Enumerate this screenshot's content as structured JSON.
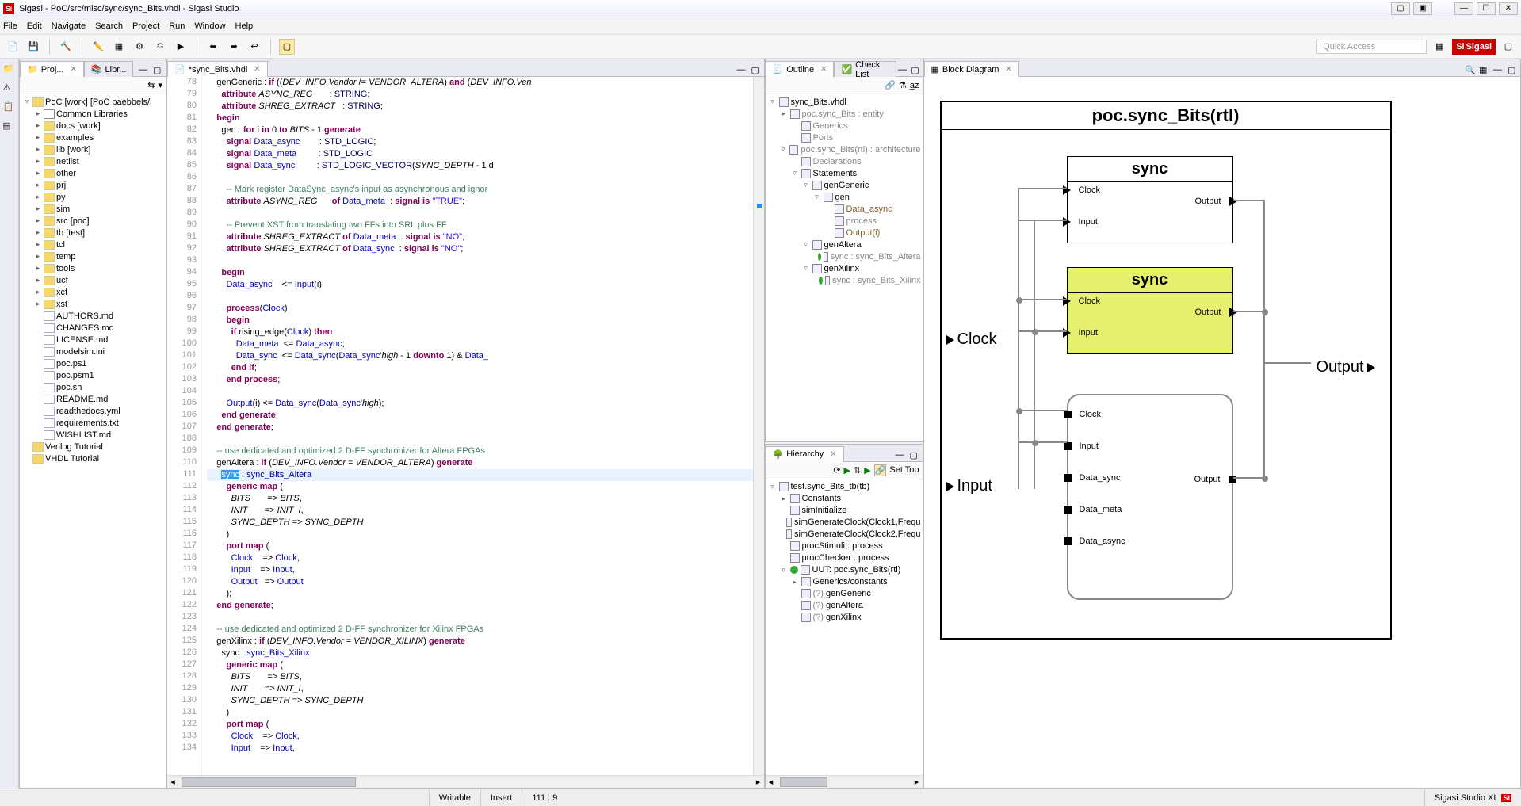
{
  "title": "Sigasi - PoC/src/misc/sync/sync_Bits.vhdl - Sigasi Studio",
  "menu": [
    "File",
    "Edit",
    "Navigate",
    "Search",
    "Project",
    "Run",
    "Window",
    "Help"
  ],
  "quick_access": "Quick Access",
  "perspective": "Sigasi",
  "tabs": {
    "project": "Proj...",
    "libraries": "Libr...",
    "editor": "*sync_Bits.vhdl",
    "outline": "Outline",
    "checklist": "Check List",
    "hierarchy": "Hierarchy",
    "block": "Block Diagram"
  },
  "project_tree": [
    {
      "d": 0,
      "e": "▿",
      "i": "fold",
      "t": "PoC [work]  [PoC paebbels/i"
    },
    {
      "d": 1,
      "e": "▸",
      "i": "pkg",
      "t": "Common Libraries"
    },
    {
      "d": 1,
      "e": "▸",
      "i": "fold",
      "t": "docs [work]"
    },
    {
      "d": 1,
      "e": "▸",
      "i": "fold",
      "t": "examples"
    },
    {
      "d": 1,
      "e": "▸",
      "i": "fold",
      "t": "lib [work]"
    },
    {
      "d": 1,
      "e": "▸",
      "i": "fold",
      "t": "netlist"
    },
    {
      "d": 1,
      "e": "▸",
      "i": "fold",
      "t": "other"
    },
    {
      "d": 1,
      "e": "▸",
      "i": "fold",
      "t": "prj"
    },
    {
      "d": 1,
      "e": "▸",
      "i": "fold",
      "t": "py"
    },
    {
      "d": 1,
      "e": "▸",
      "i": "fold",
      "t": "sim"
    },
    {
      "d": 1,
      "e": "▸",
      "i": "fold",
      "t": "src [poc]"
    },
    {
      "d": 1,
      "e": "▸",
      "i": "fold",
      "t": "tb [test]"
    },
    {
      "d": 1,
      "e": "▸",
      "i": "fold",
      "t": "tcl"
    },
    {
      "d": 1,
      "e": "▸",
      "i": "fold",
      "t": "temp"
    },
    {
      "d": 1,
      "e": "▸",
      "i": "fold",
      "t": "tools"
    },
    {
      "d": 1,
      "e": "▸",
      "i": "fold",
      "t": "ucf"
    },
    {
      "d": 1,
      "e": "▸",
      "i": "fold",
      "t": "xcf"
    },
    {
      "d": 1,
      "e": "▸",
      "i": "fold",
      "t": "xst"
    },
    {
      "d": 1,
      "e": "",
      "i": "file",
      "t": "AUTHORS.md"
    },
    {
      "d": 1,
      "e": "",
      "i": "file",
      "t": "CHANGES.md"
    },
    {
      "d": 1,
      "e": "",
      "i": "file",
      "t": "LICENSE.md"
    },
    {
      "d": 1,
      "e": "",
      "i": "file",
      "t": "modelsim.ini"
    },
    {
      "d": 1,
      "e": "",
      "i": "file",
      "t": "poc.ps1"
    },
    {
      "d": 1,
      "e": "",
      "i": "file",
      "t": "poc.psm1"
    },
    {
      "d": 1,
      "e": "",
      "i": "file",
      "t": "poc.sh"
    },
    {
      "d": 1,
      "e": "",
      "i": "file",
      "t": "README.md"
    },
    {
      "d": 1,
      "e": "",
      "i": "file",
      "t": "readthedocs.yml"
    },
    {
      "d": 1,
      "e": "",
      "i": "file",
      "t": "requirements.txt"
    },
    {
      "d": 1,
      "e": "",
      "i": "file",
      "t": "WISHLIST.md"
    },
    {
      "d": 0,
      "e": "",
      "i": "fold",
      "t": "Verilog Tutorial"
    },
    {
      "d": 0,
      "e": "",
      "i": "fold",
      "t": "VHDL Tutorial"
    }
  ],
  "code_start": 78,
  "code": [
    {
      "h": "    genGeneric : <k>if</k> ((<i>DEV_INFO.Vendor</i> /= <i>VENDOR_ALTERA</i>) <k>and</k> (<i>DEV_INFO.Ven</i>"
    },
    {
      "h": "      <k>attribute</k> <i>ASYNC_REG</i>       : <t>STRING</t>;"
    },
    {
      "h": "      <k>attribute</k> <i>SHREG_EXTRACT</i>   : <t>STRING</t>;"
    },
    {
      "h": "    <k>begin</k>"
    },
    {
      "h": "      <n>gen</n> : <k>for</k> i <k>in</k> <n>0</n> <k>to</k> <i>BITS</i> - <n>1</n> <k>generate</k>"
    },
    {
      "h": "        <k>signal</k> <id>Data_async</id>        : <t>STD_LOGIC</t>;"
    },
    {
      "h": "        <k>signal</k> <id>Data_meta</id>         : <t>STD_LOGIC</t>"
    },
    {
      "h": "        <k>signal</k> <id>Data_sync</id>         : <t>STD_LOGIC_VECTOR</t>(<i>SYNC_DEPTH</i> - <n>1</n> d"
    },
    {
      "h": ""
    },
    {
      "h": "        <c>-- Mark register DataSync_async's input as asynchronous and ignor</c>"
    },
    {
      "h": "        <k>attribute</k> <i>ASYNC_REG</i>      <k>of</k> <id>Data_meta</id>  : <k>signal is</k> <s>\"TRUE\"</s>;"
    },
    {
      "h": ""
    },
    {
      "h": "        <c>-- Prevent XST from translating two FFs into SRL plus FF</c>"
    },
    {
      "h": "        <k>attribute</k> <i>SHREG_EXTRACT</i> <k>of</k> <id>Data_meta</id>  : <k>signal is</k> <s>\"NO\"</s>;"
    },
    {
      "h": "        <k>attribute</k> <i>SHREG_EXTRACT</i> <k>of</k> <id>Data_sync</id>  : <k>signal is</k> <s>\"NO\"</s>;"
    },
    {
      "h": ""
    },
    {
      "h": "      <k>begin</k>"
    },
    {
      "h": "        <id>Data_async</id>    &lt;= <id>Input</id>(i);"
    },
    {
      "h": ""
    },
    {
      "h": "        <k>process</k>(<id>Clock</id>)"
    },
    {
      "h": "        <k>begin</k>"
    },
    {
      "h": "          <k>if</k> rising_edge(<id>Clock</id>) <k>then</k>"
    },
    {
      "h": "            <id>Data_meta</id>  &lt;= <id>Data_async</id>;"
    },
    {
      "h": "            <id>Data_sync</id>  &lt;= <id>Data_sync</id>(<id>Data_sync</id>'<i>high</i> - <n>1</n> <k>downto</k> <n>1</n>) &amp; <id>Data_</id>"
    },
    {
      "h": "          <k>end if</k>;"
    },
    {
      "h": "        <k>end process</k>;"
    },
    {
      "h": ""
    },
    {
      "h": "        <id>Output</id>(i) &lt;= <id>Data_sync</id>(<id>Data_sync</id>'<i>high</i>);"
    },
    {
      "h": "      <k>end generate</k>;"
    },
    {
      "h": "    <k>end generate</k>;"
    },
    {
      "h": ""
    },
    {
      "h": "    <c>-- use dedicated and optimized 2 D-FF synchronizer for Altera FPGAs</c>"
    },
    {
      "h": "    <n>genAltera</n> : <k>if</k> (<i>DEV_INFO.Vendor</i> = <i>VENDOR_ALTERA</i>) <k>generate</k>"
    },
    {
      "h": "      <span class='sel'>sync</span> : <id>sync_Bits_Altera</id>",
      "cur": true
    },
    {
      "h": "        <k>generic map</k> ("
    },
    {
      "h": "          <i>BITS</i>       =&gt; <i>BITS</i>,"
    },
    {
      "h": "          <i>INIT</i>       =&gt; <i>INIT_I</i>,"
    },
    {
      "h": "          <i>SYNC_DEPTH</i> =&gt; <i>SYNC_DEPTH</i>"
    },
    {
      "h": "        )"
    },
    {
      "h": "        <k>port map</k> ("
    },
    {
      "h": "          <id>Clock</id>    =&gt; <id>Clock</id>,"
    },
    {
      "h": "          <id>Input</id>    =&gt; <id>Input</id>,"
    },
    {
      "h": "          <id>Output</id>   =&gt; <id>Output</id>"
    },
    {
      "h": "        );"
    },
    {
      "h": "    <k>end generate</k>;"
    },
    {
      "h": ""
    },
    {
      "h": "    <c>-- use dedicated and optimized 2 D-FF synchronizer for Xilinx FPGAs</c>"
    },
    {
      "h": "    <n>genXilinx</n> : <k>if</k> (<i>DEV_INFO.Vendor</i> = <i>VENDOR_XILINX</i>) <k>generate</k>"
    },
    {
      "h": "      <n>sync</n> : <id>sync_Bits_Xilinx</id>"
    },
    {
      "h": "        <k>generic map</k> ("
    },
    {
      "h": "          <i>BITS</i>       =&gt; <i>BITS</i>,"
    },
    {
      "h": "          <i>INIT</i>       =&gt; <i>INIT_I</i>,"
    },
    {
      "h": "          <i>SYNC_DEPTH</i> =&gt; <i>SYNC_DEPTH</i>"
    },
    {
      "h": "        )"
    },
    {
      "h": "        <k>port map</k> ("
    },
    {
      "h": "          <id>Clock</id>    =&gt; <id>Clock</id>,"
    },
    {
      "h": "          <id>Input</id>    =&gt; <id>Input</id>,"
    }
  ],
  "outline": [
    {
      "d": 0,
      "e": "▿",
      "t": "sync_Bits.vhdl"
    },
    {
      "d": 1,
      "e": "▸",
      "t": "poc.sync_Bits",
      "suf": ": entity",
      "c": "dim"
    },
    {
      "d": 2,
      "e": "",
      "t": "Generics",
      "c": "dim"
    },
    {
      "d": 2,
      "e": "",
      "t": "Ports",
      "c": "dim"
    },
    {
      "d": 1,
      "e": "▿",
      "t": "poc.sync_Bits(rtl)",
      "suf": ": architecture",
      "c": "dim"
    },
    {
      "d": 2,
      "e": "",
      "t": "Declarations",
      "c": "dim"
    },
    {
      "d": 2,
      "e": "▿",
      "t": "Statements"
    },
    {
      "d": 3,
      "e": "▿",
      "t": "genGeneric"
    },
    {
      "d": 4,
      "e": "▿",
      "t": "gen"
    },
    {
      "d": 5,
      "e": "",
      "t": "Data_async",
      "c": "brown"
    },
    {
      "d": 5,
      "e": "",
      "t": "process",
      "c": "dim"
    },
    {
      "d": 5,
      "e": "",
      "t": "Output(i)",
      "c": "brown"
    },
    {
      "d": 3,
      "e": "▿",
      "t": "genAltera"
    },
    {
      "d": 4,
      "e": "",
      "t": "sync",
      "suf": ": sync_Bits_Altera",
      "c": "dim",
      "badge": "green"
    },
    {
      "d": 3,
      "e": "▿",
      "t": "genXilinx"
    },
    {
      "d": 4,
      "e": "",
      "t": "sync",
      "suf": ": sync_Bits_Xilinx",
      "c": "dim",
      "badge": "green"
    }
  ],
  "hierarchy_toolbar": {
    "settop": "Set Top"
  },
  "hierarchy": [
    {
      "d": 0,
      "e": "▿",
      "t": "test.sync_Bits_tb(tb)"
    },
    {
      "d": 1,
      "e": "▸",
      "t": "Constants"
    },
    {
      "d": 1,
      "e": "",
      "t": "simInitialize"
    },
    {
      "d": 1,
      "e": "",
      "t": "simGenerateClock(Clock1,Frequ"
    },
    {
      "d": 1,
      "e": "",
      "t": "simGenerateClock(Clock2,Frequ"
    },
    {
      "d": 1,
      "e": "",
      "t": "procStimuli : process"
    },
    {
      "d": 1,
      "e": "",
      "t": "procChecker : process"
    },
    {
      "d": 1,
      "e": "▿",
      "t": "UUT: poc.sync_Bits(rtl)",
      "badge": "green"
    },
    {
      "d": 2,
      "e": "▸",
      "t": "Generics/constants"
    },
    {
      "d": 2,
      "e": "",
      "t": "genGeneric",
      "pre": "(?)"
    },
    {
      "d": 2,
      "e": "",
      "t": "genAltera",
      "pre": "(?)"
    },
    {
      "d": 2,
      "e": "",
      "t": "genXilinx",
      "pre": "(?)"
    }
  ],
  "diagram": {
    "title": "poc.sync_Bits(rtl)",
    "blocks": [
      {
        "name": "sync",
        "ports_in": [
          "Clock",
          "Input"
        ],
        "ports_out": [
          "Output"
        ],
        "hl": false
      },
      {
        "name": "sync",
        "ports_in": [
          "Clock",
          "Input"
        ],
        "ports_out": [
          "Output"
        ],
        "hl": true
      },
      {
        "name": "",
        "ports_in": [
          "Clock",
          "Input",
          "Data_sync",
          "Data_meta",
          "Data_async"
        ],
        "ports_out": [
          "Output"
        ],
        "rounded": true
      }
    ],
    "ext_in": [
      "Clock",
      "Input"
    ],
    "ext_out": [
      "Output"
    ]
  },
  "status": {
    "writable": "Writable",
    "insert": "Insert",
    "pos": "111 : 9",
    "product": "Sigasi Studio XL"
  }
}
